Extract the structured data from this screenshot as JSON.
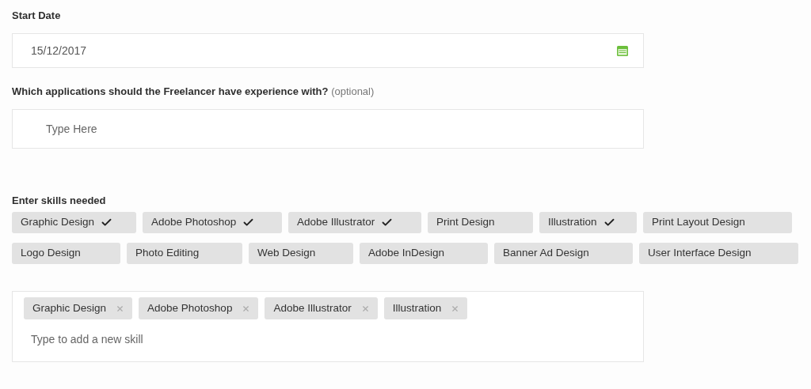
{
  "start_date": {
    "label": "Start Date",
    "value": "15/12/2017"
  },
  "applications": {
    "label": "Which applications should the Freelancer have experience with?",
    "note": "(optional)",
    "placeholder": "Type Here"
  },
  "skills": {
    "label": "Enter skills needed",
    "rows": [
      [
        {
          "label": "Graphic Design",
          "selected": true
        },
        {
          "label": "Adobe Photoshop",
          "selected": true
        },
        {
          "label": "Adobe Illustrator",
          "selected": true
        },
        {
          "label": "Print Design",
          "selected": false
        },
        {
          "label": "Illustration",
          "selected": true
        },
        {
          "label": "Print Layout Design",
          "selected": false
        }
      ],
      [
        {
          "label": "Logo Design",
          "selected": false
        },
        {
          "label": "Photo Editing",
          "selected": false
        },
        {
          "label": "Web Design",
          "selected": false
        },
        {
          "label": "Adobe InDesign",
          "selected": false
        },
        {
          "label": "Banner Ad Design",
          "selected": false
        },
        {
          "label": "User Interface Design",
          "selected": false
        }
      ]
    ]
  },
  "chosen_skills": {
    "tags": [
      "Graphic Design",
      "Adobe Photoshop",
      "Adobe Illustrator",
      "Illustration"
    ],
    "placeholder": "Type to add a new skill"
  }
}
